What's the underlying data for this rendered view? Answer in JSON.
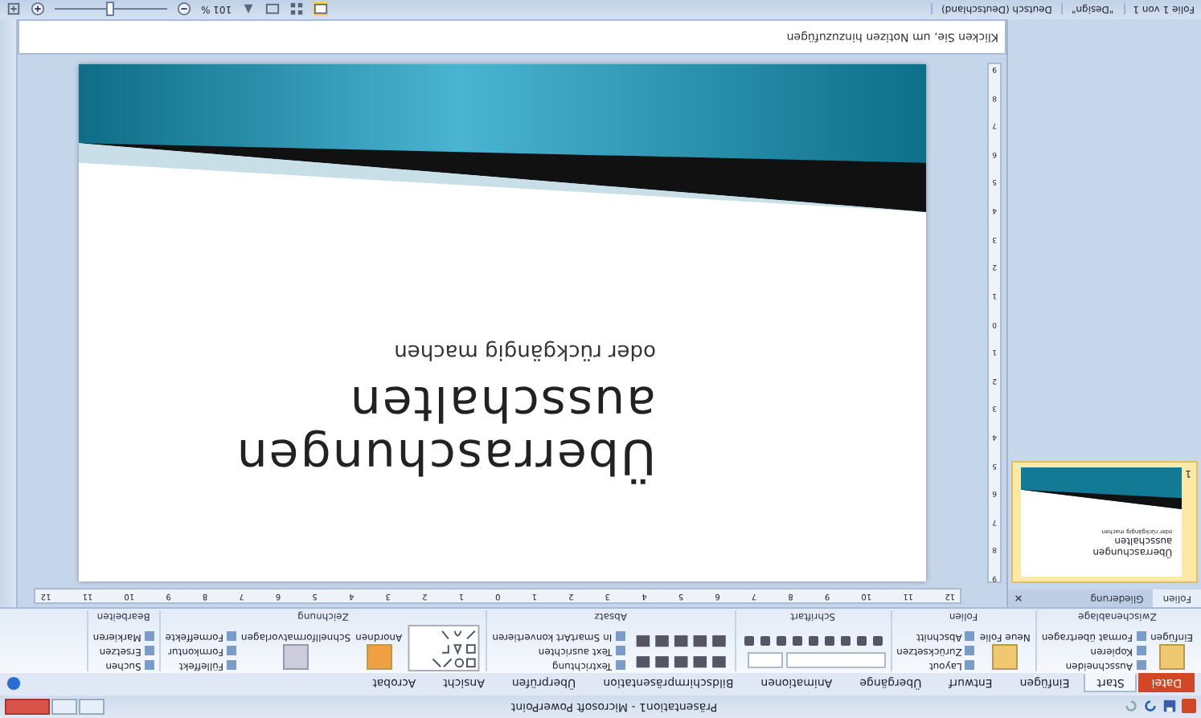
{
  "window": {
    "title": "Präsentation1 - Microsoft PowerPoint"
  },
  "tabs": [
    {
      "label": "Datei",
      "kind": "file",
      "selected": false
    },
    {
      "label": "Start",
      "kind": "tab",
      "selected": true
    },
    {
      "label": "Einfügen",
      "kind": "tab",
      "selected": false
    },
    {
      "label": "Entwurf",
      "kind": "tab",
      "selected": false
    },
    {
      "label": "Übergänge",
      "kind": "tab",
      "selected": false
    },
    {
      "label": "Animationen",
      "kind": "tab",
      "selected": false
    },
    {
      "label": "Bildschirmpräsentation",
      "kind": "tab",
      "selected": false
    },
    {
      "label": "Überprüfen",
      "kind": "tab",
      "selected": false
    },
    {
      "label": "Ansicht",
      "kind": "tab",
      "selected": false
    },
    {
      "label": "Acrobat",
      "kind": "tab",
      "selected": false
    }
  ],
  "ribbon_groups": [
    {
      "name": "Zwischenablage",
      "large": "Einfügen",
      "items": [
        "Ausschneiden",
        "Kopieren",
        "Format übertragen"
      ]
    },
    {
      "name": "Folien",
      "large": "Neue Folie",
      "items": [
        "Layout",
        "Zurücksetzen",
        "Abschnitt"
      ]
    },
    {
      "name": "Schriftart",
      "kind": "font"
    },
    {
      "name": "Absatz",
      "kind": "paragraph",
      "items": [
        "Textrichtung",
        "Text ausrichten",
        "In SmartArt konvertieren"
      ]
    },
    {
      "name": "Zeichnung",
      "kind": "drawing",
      "large": "Anordnen",
      "large2": "Schnellformatvorlagen",
      "items": [
        "Fülleffekt",
        "Formkontur",
        "Formeffekte"
      ]
    },
    {
      "name": "Bearbeiten",
      "items": [
        "Suchen",
        "Ersetzen",
        "Markieren"
      ]
    }
  ],
  "panel": {
    "tabs": [
      {
        "label": "Folien",
        "selected": true
      },
      {
        "label": "Gliederung",
        "selected": false
      }
    ],
    "thumbnails": [
      {
        "number": "1",
        "title": "Überraschungen ausschalten",
        "subtitle": "oder rückgängig machen",
        "selected": true
      }
    ]
  },
  "ruler": {
    "labels": [
      "12",
      "11",
      "10",
      "9",
      "8",
      "7",
      "6",
      "5",
      "4",
      "3",
      "2",
      "1",
      "0",
      "1",
      "2",
      "3",
      "4",
      "5",
      "6",
      "7",
      "8",
      "9",
      "10",
      "11",
      "12"
    ],
    "vlabels": [
      "9",
      "8",
      "7",
      "6",
      "5",
      "4",
      "3",
      "2",
      "1",
      "0",
      "1",
      "2",
      "3",
      "4",
      "5",
      "6",
      "7",
      "8",
      "9"
    ]
  },
  "slide": {
    "title": "Überraschungen ausschalten",
    "subtitle": "oder rückgängig machen"
  },
  "notes": {
    "placeholder": "Klicken Sie, um Notizen hinzuzufügen"
  },
  "status_bar": {
    "items": [
      "Folie 1 von 1",
      "\"Design\"",
      "Deutsch (Deutschland)"
    ],
    "zoom": "101 %",
    "level": 0.5
  }
}
